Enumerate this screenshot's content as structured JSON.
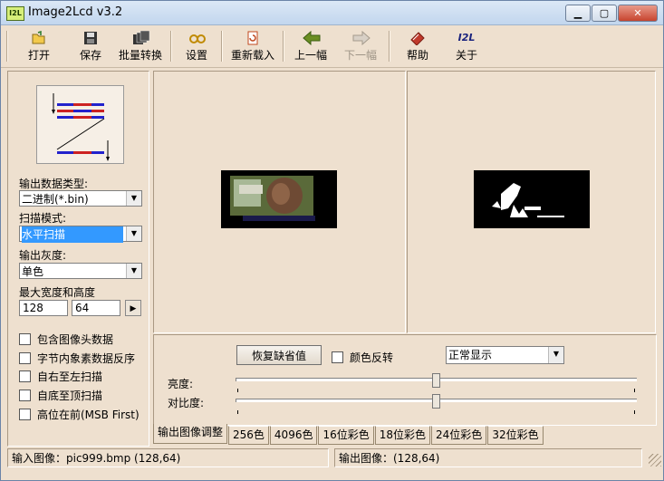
{
  "window": {
    "title": "Image2Lcd v3.2",
    "app_icon_text": "I2L"
  },
  "toolbar": {
    "open": "打开",
    "save": "保存",
    "batch": "批量转换",
    "settings": "设置",
    "reload": "重新载入",
    "prev": "上一幅",
    "next": "下一幅",
    "help": "帮助",
    "about": "关于",
    "about_icon_text": "I2L"
  },
  "left": {
    "output_type_label": "输出数据类型:",
    "output_type_value": "二进制(*.bin)",
    "scan_mode_label": "扫描模式:",
    "scan_mode_value": "水平扫描",
    "gray_label": "输出灰度:",
    "gray_value": "单色",
    "maxsize_label": "最大宽度和高度",
    "max_width": "128",
    "max_height": "64",
    "options": [
      "包含图像头数据",
      "字节内象素数据反序",
      "自右至左扫描",
      "自底至顶扫描",
      "高位在前(MSB First)"
    ]
  },
  "adjust": {
    "restore_button": "恢复缺省值",
    "invert_label": "颜色反转",
    "display_mode": "正常显示",
    "brightness_label": "亮度:",
    "contrast_label": "对比度:",
    "brightness_level": 0.5,
    "contrast_level": 0.5
  },
  "tabs": [
    "输出图像调整",
    "256色",
    "4096色",
    "16位彩色",
    "18位彩色",
    "24位彩色",
    "32位彩色"
  ],
  "status": {
    "input": "输入图像：pic999.bmp (128,64)",
    "output": "输出图像：(128,64)"
  },
  "colors": {
    "selection": "#3399ff",
    "panel": "#eee0cf"
  }
}
